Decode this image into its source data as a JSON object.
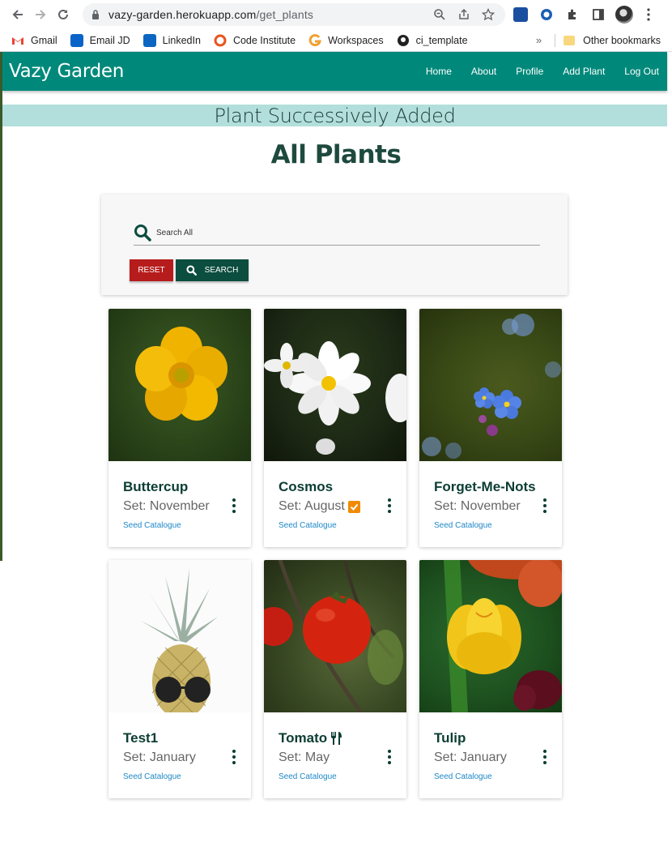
{
  "browser": {
    "url_host": "vazy-garden.herokuapp.com",
    "url_path": "/get_plants",
    "bookmarks": [
      {
        "label": "Gmail",
        "icon": "gmail-icon",
        "color": "#ea4335"
      },
      {
        "label": "Email JD",
        "icon": "outlook-icon",
        "color": "#0a64c8"
      },
      {
        "label": "LinkedIn",
        "icon": "linkedin-icon",
        "color": "#0a66c2"
      },
      {
        "label": "Code Institute",
        "icon": "code-institute-icon",
        "color": "#e8541f"
      },
      {
        "label": "Workspaces",
        "icon": "workspaces-icon",
        "color": "#f0a030"
      },
      {
        "label": "ci_template",
        "icon": "github-icon",
        "color": "#222222"
      }
    ],
    "more_label": "»",
    "other_bookmarks": "Other bookmarks"
  },
  "nav": {
    "brand": "Vazy Garden",
    "links": [
      "Home",
      "About",
      "Profile",
      "Add Plant",
      "Log Out"
    ],
    "color": "#00897b"
  },
  "flash": "Plant Successively Added",
  "page_title": "All Plants",
  "search": {
    "placeholder": "Search All",
    "reset_label": "Reset",
    "search_label": "Search"
  },
  "plants": [
    {
      "name": "Buttercup",
      "set": "Set: November",
      "link": "Seed Catalogue",
      "image": "buttercup",
      "badge": null
    },
    {
      "name": "Cosmos",
      "set": "Set: August",
      "link": "Seed Catalogue",
      "image": "cosmos",
      "badge": "check"
    },
    {
      "name": "Forget-Me-Nots",
      "set": "Set: November",
      "link": "Seed Catalogue",
      "image": "forget-me-nots",
      "badge": null
    },
    {
      "name": "Test1",
      "set": "Set: January",
      "link": "Seed Catalogue",
      "image": "pineapple",
      "badge": null
    },
    {
      "name": "Tomato",
      "set": "Set: May",
      "link": "Seed Catalogue",
      "image": "tomato",
      "badge": "utensils"
    },
    {
      "name": "Tulip",
      "set": "Set: January",
      "link": "Seed Catalogue",
      "image": "tulip",
      "badge": null
    }
  ]
}
